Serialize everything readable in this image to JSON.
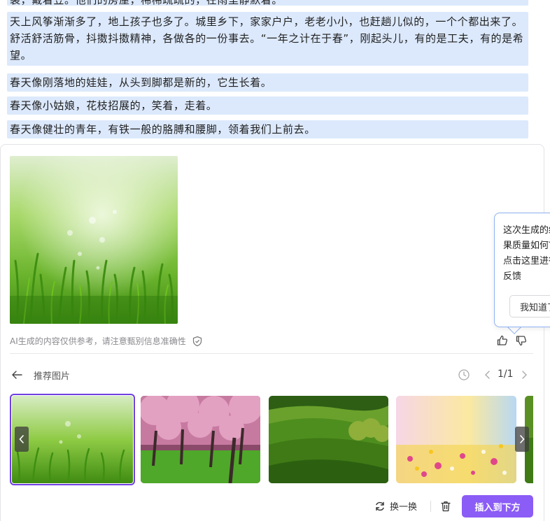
{
  "document": {
    "paragraphs": [
      "裳，戴着笠。他们的房屋，稀稀疏疏的，在雨里静默着。",
      "天上风筝渐渐多了，地上孩子也多了。城里乡下，家家户户，老老小小，也赶趟儿似的，一个个都出来了。舒活舒活筋骨，抖擞抖擞精神，各做各的一份事去。“一年之计在于春”，刚起头儿，有的是工夫，有的是希望。",
      "春天像刚落地的娃娃，从头到脚都是新的，它生长着。",
      "春天像小姑娘，花枝招展的，笑着，走着。",
      "春天像健壮的青年，有铁一般的胳膊和腰脚，领着我们上前去。"
    ]
  },
  "ai_panel": {
    "disclaimer": "AI生成的内容仅供参考，请注意甄别信息准确性",
    "recommend_title": "推荐图片",
    "pagination": "1/1",
    "thumbnails": [
      "grass-dew",
      "cherry-blossom-trees",
      "green-hills",
      "flower-meadow",
      "green-edge"
    ],
    "selected_index": 0,
    "swap_label": "换一换",
    "insert_label": "插入到下方",
    "accent_color": "#8b5cf6"
  },
  "tooltip": {
    "text": "这次生成的结果质量如何？点击这里进行反馈",
    "button": "我知道了"
  },
  "icons": [
    "shield-icon",
    "thumbs-up-icon",
    "thumbs-down-icon",
    "back-arrow-icon",
    "history-icon",
    "chevron-left-icon",
    "chevron-right-icon",
    "refresh-icon",
    "trash-icon"
  ]
}
